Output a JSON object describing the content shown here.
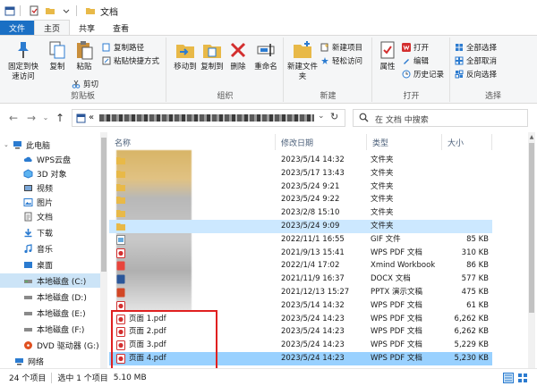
{
  "window": {
    "title": "文档"
  },
  "ribbon_tabs": [
    "文件",
    "主页",
    "共享",
    "查看"
  ],
  "ribbon": {
    "clipboard": {
      "pin_label": "固定到快速访问",
      "copy_label": "复制",
      "paste_label": "粘贴",
      "copy_path_label": "复制路径",
      "paste_shortcut_label": "粘贴快捷方式",
      "cut_label": "剪切",
      "group_label": "剪贴板"
    },
    "organize": {
      "move_label": "移动到",
      "copy_to_label": "复制到",
      "delete_label": "删除",
      "rename_label": "重命名",
      "group_label": "组织"
    },
    "new": {
      "folder_label": "新建文件夹",
      "new_item_label": "新建项目",
      "easy_access_label": "轻松访问",
      "group_label": "新建"
    },
    "open": {
      "properties_label": "属性",
      "open_label": "打开",
      "edit_label": "编辑",
      "history_label": "历史记录",
      "group_label": "打开"
    },
    "select": {
      "select_all_label": "全部选择",
      "select_none_label": "全部取消",
      "invert_label": "反向选择",
      "group_label": "选择"
    }
  },
  "address": {
    "prefix": "«",
    "search_placeholder": "在 文档 中搜索"
  },
  "nav_items": [
    {
      "label": "此电脑"
    },
    {
      "label": "WPS云盘"
    },
    {
      "label": "3D 对象"
    },
    {
      "label": "视频"
    },
    {
      "label": "图片"
    },
    {
      "label": "文档"
    },
    {
      "label": "下载"
    },
    {
      "label": "音乐"
    },
    {
      "label": "桌面"
    },
    {
      "label": "本地磁盘 (C:)"
    },
    {
      "label": "本地磁盘 (D:)"
    },
    {
      "label": "本地磁盘 (E:)"
    },
    {
      "label": "本地磁盘 (F:)"
    },
    {
      "label": "DVD 驱动器 (G:)"
    },
    {
      "label": "网络"
    }
  ],
  "columns": {
    "name": "名称",
    "date": "修改日期",
    "type": "类型",
    "size": "大小"
  },
  "files": [
    {
      "name": "",
      "date": "2023/5/14 14:32",
      "type": "文件夹",
      "size": ""
    },
    {
      "name": "",
      "date": "2023/5/17 13:43",
      "type": "文件夹",
      "size": ""
    },
    {
      "name": "",
      "date": "2023/5/24 9:21",
      "type": "文件夹",
      "size": ""
    },
    {
      "name": "",
      "date": "2023/5/24 9:22",
      "type": "文件夹",
      "size": ""
    },
    {
      "name": "",
      "date": "2023/2/8 15:10",
      "type": "文件夹",
      "size": ""
    },
    {
      "name": "",
      "date": "2023/5/24 9:09",
      "type": "文件夹",
      "size": ""
    },
    {
      "name": "",
      "date": "2022/11/1 16:55",
      "type": "GIF 文件",
      "size": "85 KB"
    },
    {
      "name": "",
      "date": "2021/9/13 15:41",
      "type": "WPS PDF 文档",
      "size": "310 KB"
    },
    {
      "name": "",
      "date": "2022/1/4 17:02",
      "type": "Xmind Workbook",
      "size": "86 KB"
    },
    {
      "name": "",
      "date": "2021/11/9 16:37",
      "type": "DOCX 文档",
      "size": "577 KB"
    },
    {
      "name": "",
      "date": "2021/12/13 15:27",
      "type": "PPTX 演示文稿",
      "size": "475 KB"
    },
    {
      "name": "",
      "date": "2023/5/14 14:32",
      "type": "WPS PDF 文档",
      "size": "61 KB"
    },
    {
      "name": "页面 1.pdf",
      "date": "2023/5/24 14:23",
      "type": "WPS PDF 文档",
      "size": "6,262 KB"
    },
    {
      "name": "页面 2.pdf",
      "date": "2023/5/24 14:23",
      "type": "WPS PDF 文档",
      "size": "6,262 KB"
    },
    {
      "name": "页面 3.pdf",
      "date": "2023/5/24 14:23",
      "type": "WPS PDF 文档",
      "size": "5,229 KB"
    },
    {
      "name": "页面 4.pdf",
      "date": "2023/5/24 14:23",
      "type": "WPS PDF 文档",
      "size": "5,230 KB"
    }
  ],
  "status": {
    "count": "24 个项目",
    "selected": "选中 1 个项目",
    "size": "5.10 MB"
  },
  "colors": {
    "accent": "#1a6fc4",
    "selection": "#99d1ff",
    "hover": "#cce8ff",
    "highlight_box": "#e02020",
    "pdf_red": "#d32f2f",
    "folder": "#e8b948"
  }
}
